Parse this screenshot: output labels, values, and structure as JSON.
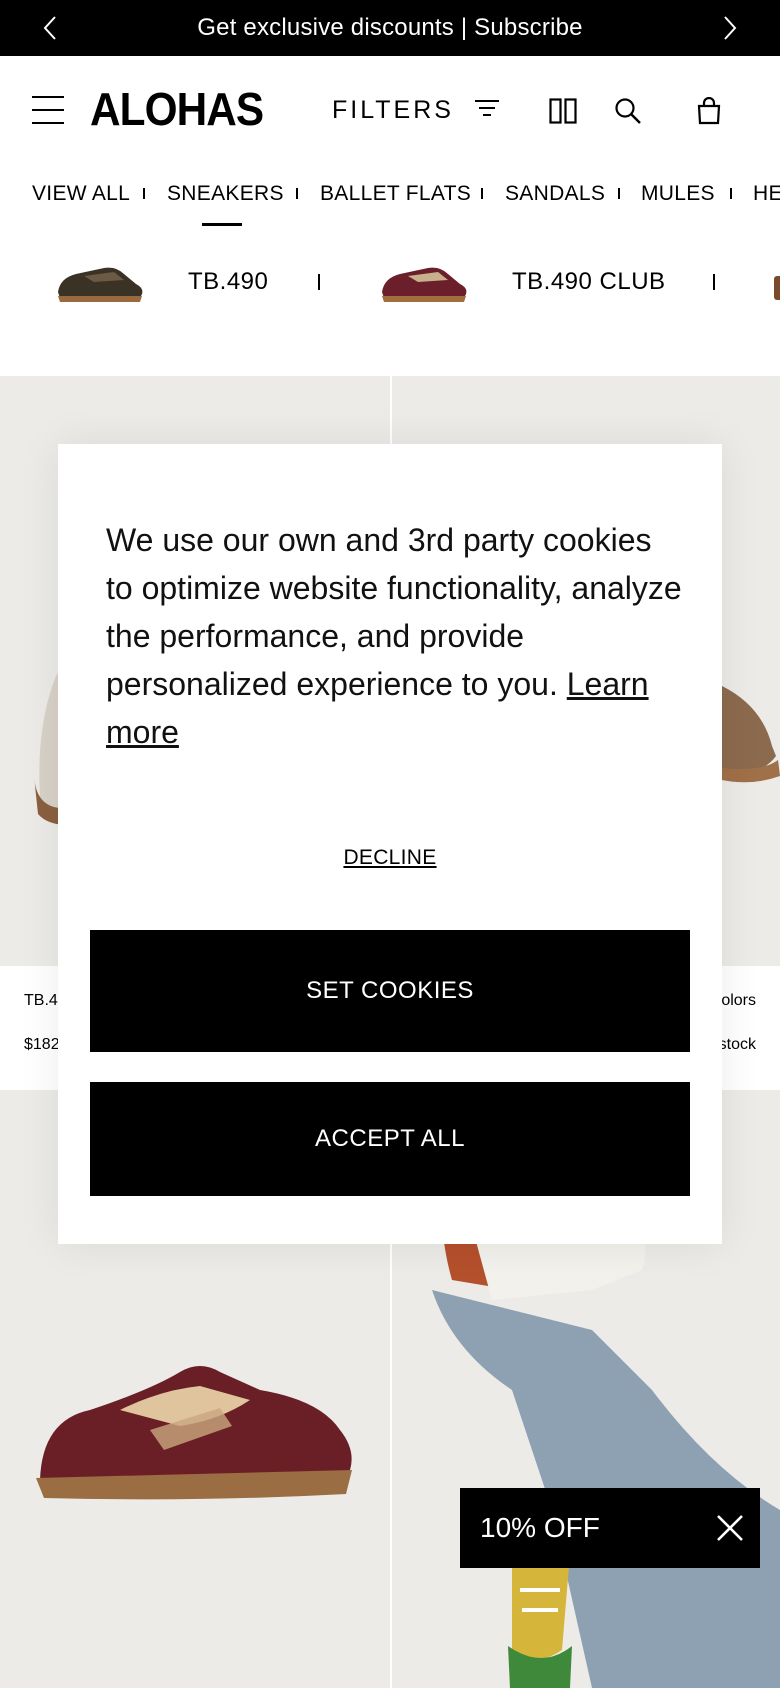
{
  "announcement": {
    "text": "Get exclusive discounts | Subscribe",
    "prev_icon": "chevron-left-icon",
    "next_icon": "chevron-right-icon"
  },
  "header": {
    "logo": "ALOHAS",
    "filters_label": "FILTERS",
    "icons": [
      "menu-icon",
      "filter-icon",
      "grid-view-icon",
      "search-icon",
      "bag-icon"
    ]
  },
  "categories": {
    "items": [
      "VIEW ALL",
      "SNEAKERS",
      "BALLET FLATS",
      "SANDALS",
      "MULES",
      "HE"
    ],
    "active": "SNEAKERS"
  },
  "models": {
    "items": [
      "TB.490",
      "TB.490 CLUB"
    ]
  },
  "products": {
    "card1_name": "TB.4",
    "card1_price": "$182",
    "card2_colors": "olors",
    "card2_stock": "stock"
  },
  "cookie_modal": {
    "message": "We use our own and 3rd party cookies to optimize website functionality, analyze the performance, and provide personalized experience to you.",
    "learn_more": "Learn more",
    "decline": "DECLINE",
    "set_cookies": "SET COOKIES",
    "accept_all": "ACCEPT ALL"
  },
  "promo": {
    "label": "10% OFF",
    "close_icon": "close-icon"
  },
  "colors": {
    "black": "#000000",
    "tile_bg": "#ecebe8",
    "white": "#ffffff"
  }
}
